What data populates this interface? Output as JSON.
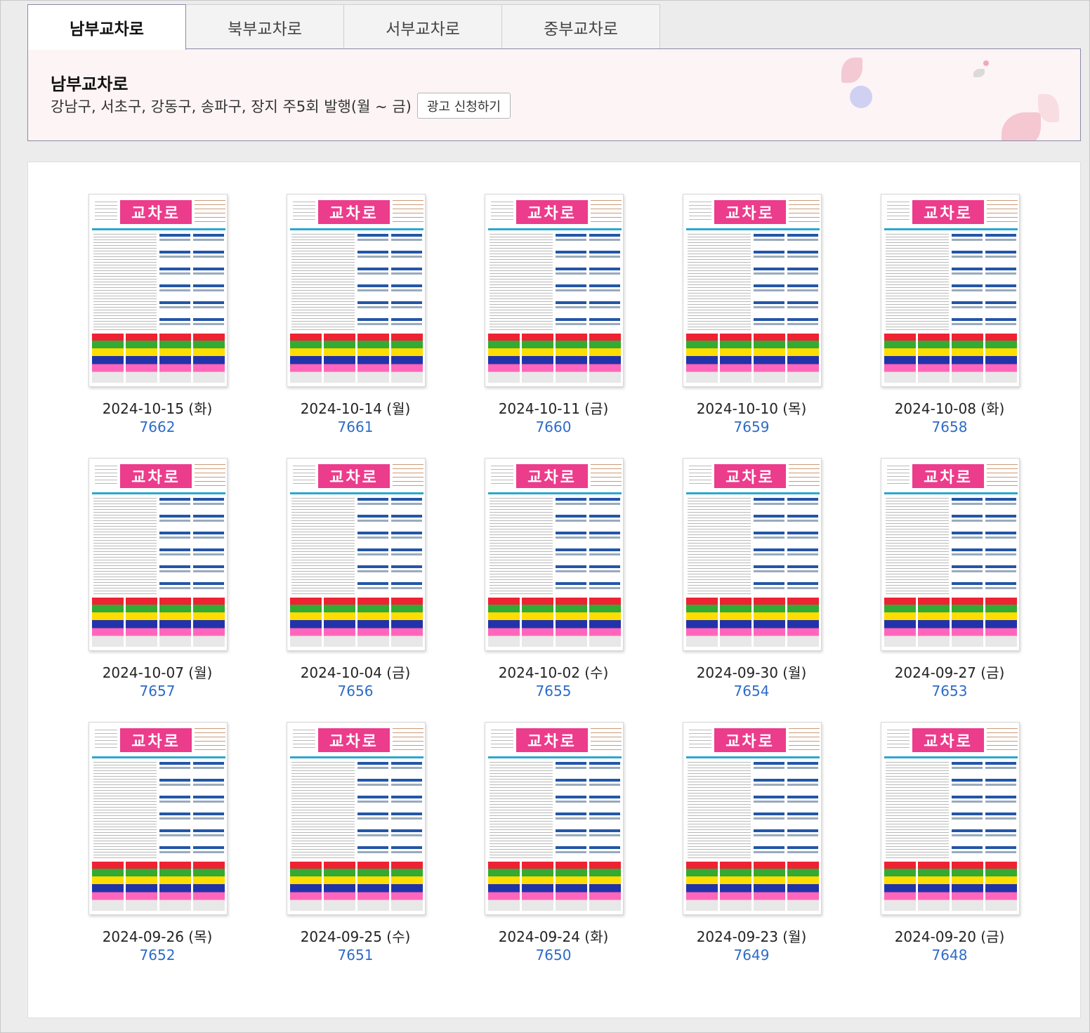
{
  "tabs": [
    {
      "label": "남부교차로",
      "active": true
    },
    {
      "label": "북부교차로",
      "active": false
    },
    {
      "label": "서부교차로",
      "active": false
    },
    {
      "label": "중부교차로",
      "active": false
    }
  ],
  "header": {
    "title": "남부교차로",
    "description": "강남구, 서초구, 강동구, 송파구, 장지 주5회 발행(월 ~ 금)",
    "apply_button": "광고 신청하기"
  },
  "thumbnail_logo": "교차로",
  "issues": [
    {
      "date": "2024-10-15 (화)",
      "number": "7662"
    },
    {
      "date": "2024-10-14 (월)",
      "number": "7661"
    },
    {
      "date": "2024-10-11 (금)",
      "number": "7660"
    },
    {
      "date": "2024-10-10 (목)",
      "number": "7659"
    },
    {
      "date": "2024-10-08 (화)",
      "number": "7658"
    },
    {
      "date": "2024-10-07 (월)",
      "number": "7657"
    },
    {
      "date": "2024-10-04 (금)",
      "number": "7656"
    },
    {
      "date": "2024-10-02 (수)",
      "number": "7655"
    },
    {
      "date": "2024-09-30 (월)",
      "number": "7654"
    },
    {
      "date": "2024-09-27 (금)",
      "number": "7653"
    },
    {
      "date": "2024-09-26 (목)",
      "number": "7652"
    },
    {
      "date": "2024-09-25 (수)",
      "number": "7651"
    },
    {
      "date": "2024-09-24 (화)",
      "number": "7650"
    },
    {
      "date": "2024-09-23 (월)",
      "number": "7649"
    },
    {
      "date": "2024-09-20 (금)",
      "number": "7648"
    }
  ],
  "colors": {
    "accent_link": "#2d6bc8",
    "logo_pink": "#ec3c8c",
    "panel_bg": "#fdf4f6"
  }
}
